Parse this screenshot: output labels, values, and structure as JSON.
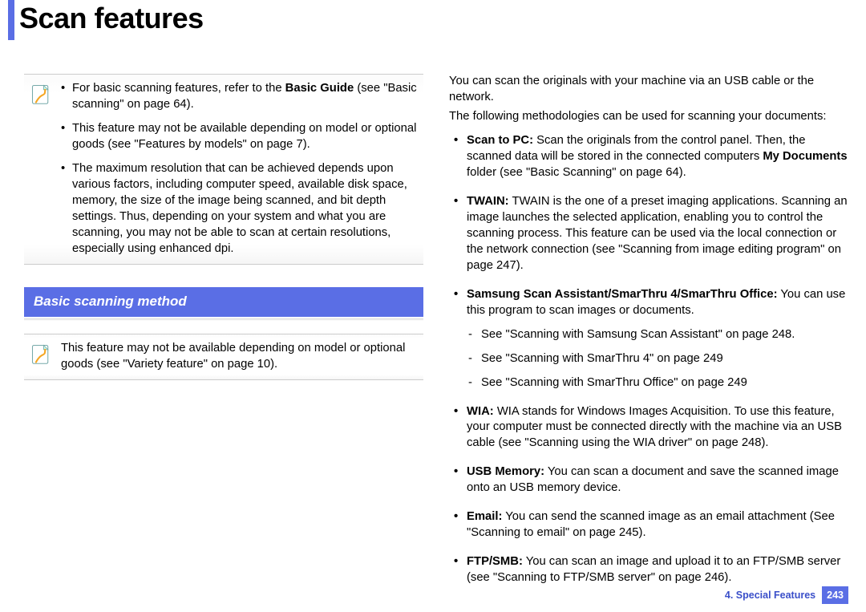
{
  "header": {
    "title": "Scan features"
  },
  "leftCol": {
    "note1": {
      "items": [
        "For basic scanning features, refer to the Basic Guide (see \"Basic scanning\" on page 64).",
        "This feature may not be available depending on model or optional goods (see \"Features by models\" on page 7).",
        "The maximum resolution that can be achieved depends upon various factors, including computer speed, available disk space, memory, the size of the image being scanned, and bit depth settings. Thus, depending on your system and what you are scanning, you may not be able to scan at certain resolutions, especially using enhanced dpi."
      ]
    },
    "sectionHead": "Basic scanning method",
    "note2": "This feature may not be available depending on model or optional goods (see \"Variety feature\" on page 10)."
  },
  "rightCol": {
    "intro1": "You can scan the originals with your machine via an USB cable or the network.",
    "intro2": "The following methodologies can be used for scanning your documents:",
    "methods": [
      {
        "label": "Scan to PC:",
        "text": " Scan the originals from the control panel. Then, the scanned data will be stored in the connected computers ",
        "bold2": "My Documents",
        "text2": " folder (see \"Basic Scanning\" on page 64)."
      },
      {
        "label": "TWAIN:",
        "text": " TWAIN is the one of a preset imaging applications. Scanning an image launches the selected application, enabling you to control the scanning process. This feature can be used via the local connection or the network connection (see \"Scanning from image editing program\" on page 247)."
      },
      {
        "label": "Samsung Scan Assistant/SmarThru 4/SmarThru Office:",
        "text": " You can use this program to scan images or documents.",
        "subs": [
          "See \"Scanning with Samsung Scan Assistant\" on page 248.",
          "See \"Scanning with SmarThru 4\" on page 249",
          "See \"Scanning with SmarThru Office\" on page 249"
        ]
      },
      {
        "label": "WIA:",
        "text": " WIA stands for Windows Images Acquisition. To use this feature, your computer must be connected directly with the machine via an USB cable (see \"Scanning using the WIA driver\" on page 248)."
      },
      {
        "label": "USB Memory:",
        "text": " You can scan a document and save the scanned image onto an USB memory device."
      },
      {
        "label": "Email:",
        "text": " You can send the scanned image as an email attachment (See \"Scanning to email\" on page 245)."
      },
      {
        "label": "FTP/SMB:",
        "text": " You can scan an image and upload it to an FTP/SMB server (see \"Scanning to FTP/SMB server\" on page 246)."
      }
    ]
  },
  "footer": {
    "chapter": "4.  Special Features",
    "page": "243"
  }
}
